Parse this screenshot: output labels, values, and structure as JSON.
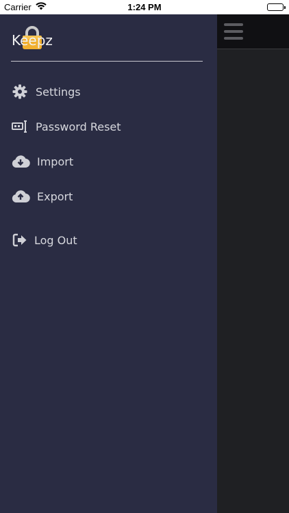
{
  "status_bar": {
    "carrier": "Carrier",
    "time": "1:24 PM"
  },
  "app": {
    "title": "Keepz",
    "accent_color": "#f2b02f"
  },
  "menu": {
    "items": [
      {
        "label": "Settings",
        "icon": "gear-icon"
      },
      {
        "label": "Password Reset",
        "icon": "password-reset-icon"
      },
      {
        "label": "Import",
        "icon": "cloud-download-icon"
      },
      {
        "label": "Export",
        "icon": "cloud-upload-icon"
      },
      {
        "label": "Log Out",
        "icon": "logout-icon"
      }
    ]
  },
  "colors": {
    "drawer_bg": "#2a2c43",
    "content_bg": "#1f2023",
    "topbar_bg": "#101013",
    "menu_text": "#d7d8de"
  }
}
